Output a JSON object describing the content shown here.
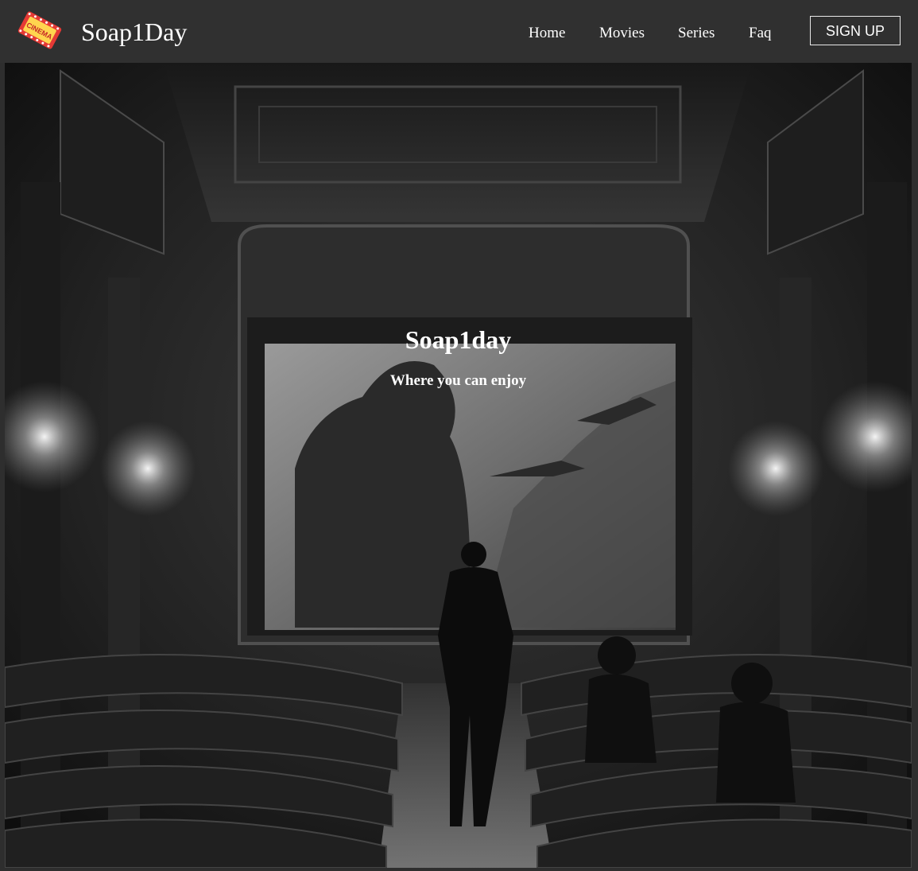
{
  "header": {
    "logo_icon": "cinema-ticket-icon",
    "logo_text": "CINEMA",
    "brand": "Soap1Day",
    "nav": [
      {
        "label": "Home"
      },
      {
        "label": "Movies"
      },
      {
        "label": "Series"
      },
      {
        "label": "Faq"
      }
    ],
    "signup_label": "SIGN UP"
  },
  "hero": {
    "title": "Soap1day",
    "subtitle": "Where you can enjoy",
    "background": "cinema-theater-illustration"
  },
  "colors": {
    "navbar": "#303030",
    "page_background": "#2e2e2e",
    "text": "#ffffff",
    "logo_red": "#e53935",
    "logo_yellow": "#ffd54f"
  }
}
